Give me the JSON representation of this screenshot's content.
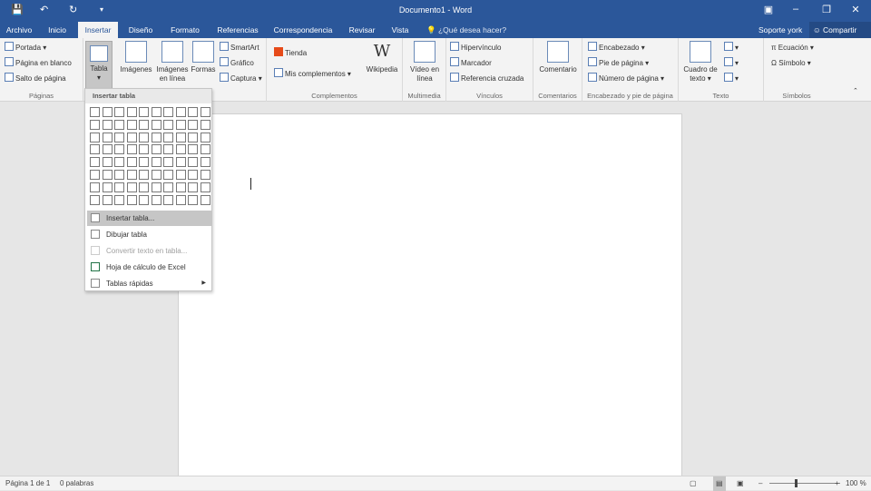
{
  "title_bar": {
    "doc_title": "Documento1 - Word",
    "save_icon": "save-icon",
    "undo_icon": "undo-icon",
    "redo_icon": "redo-icon",
    "customize_icon": "customize-qat-icon"
  },
  "tabs": [
    "Archivo",
    "Inicio",
    "Insertar",
    "Diseño",
    "Formato",
    "Referencias",
    "Correspondencia",
    "Revisar",
    "Vista"
  ],
  "active_tab": "Insertar",
  "tell_me": "¿Qué desea hacer?",
  "account": "Soporte york",
  "share": "Compartir",
  "ribbon": {
    "paginas": {
      "label": "Páginas",
      "items": [
        "Portada",
        "Página en blanco",
        "Salto de página"
      ]
    },
    "tablas": {
      "label": "Tabla"
    },
    "ilustraciones": {
      "items": [
        "Imágenes",
        "Imágenes en línea",
        "Formas",
        "SmartArt",
        "Gráfico",
        "Captura"
      ]
    },
    "complementos": {
      "label": "Complementos",
      "items": [
        "Tienda",
        "Mis complementos",
        "Wikipedia"
      ]
    },
    "multimedia": {
      "label": "Multimedia",
      "items": [
        "Vídeo en línea"
      ]
    },
    "vinculos": {
      "label": "Vínculos",
      "items": [
        "Hipervínculo",
        "Marcador",
        "Referencia cruzada"
      ]
    },
    "comentarios": {
      "label": "Comentarios",
      "items": [
        "Comentario"
      ]
    },
    "encabezado": {
      "label": "Encabezado y pie de página",
      "items": [
        "Encabezado",
        "Pie de página",
        "Número de página"
      ]
    },
    "texto": {
      "label": "Texto",
      "items": [
        "Cuadro de texto"
      ]
    },
    "simbolos": {
      "label": "Símbolos",
      "items": [
        "Ecuación",
        "Símbolo"
      ]
    }
  },
  "dropdown": {
    "header": "Insertar tabla",
    "items": [
      "Insertar tabla...",
      "Dibujar tabla",
      "Convertir texto en tabla...",
      "Hoja de cálculo de Excel",
      "Tablas rápidas"
    ]
  },
  "status": {
    "page": "Página 1 de 1",
    "words": "0 palabras",
    "zoom": "100 %"
  },
  "zoom_level": 100,
  "colors": {
    "accent": "#2b579a"
  }
}
